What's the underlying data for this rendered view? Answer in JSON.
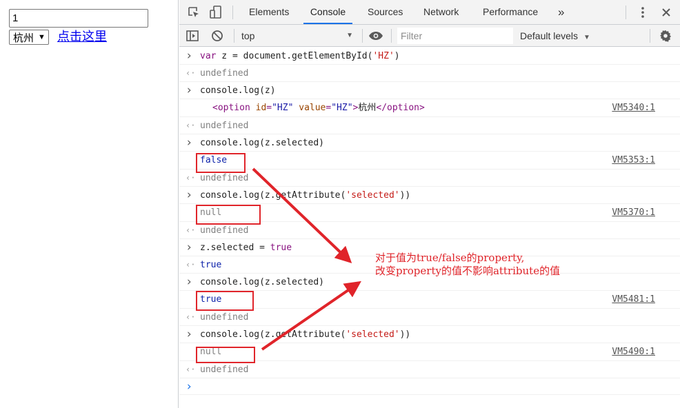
{
  "page": {
    "input_value": "1",
    "select_value": "杭州",
    "link_text": "点击这里"
  },
  "devtools": {
    "tabs": [
      "Elements",
      "Console",
      "Sources",
      "Network",
      "Performance"
    ],
    "active_tab": "Console",
    "more_tabs": "»",
    "context": "top",
    "filter_placeholder": "Filter",
    "levels": "Default levels"
  },
  "console": [
    {
      "kind": "input",
      "parts": [
        [
          "kw",
          "var"
        ],
        [
          "plain",
          " z = document.getElementById("
        ],
        [
          "str",
          "'HZ'"
        ],
        [
          "plain",
          ")"
        ]
      ]
    },
    {
      "kind": "return",
      "parts": [
        [
          "undef",
          "undefined"
        ]
      ]
    },
    {
      "kind": "input",
      "parts": [
        [
          "plain",
          "console.log(z)"
        ]
      ]
    },
    {
      "kind": "log",
      "parts": [
        [
          "tag",
          "<option "
        ],
        [
          "attr",
          "id"
        ],
        [
          "tag",
          "="
        ],
        [
          "aval",
          "\"HZ\""
        ],
        [
          "plain",
          " "
        ],
        [
          "attr",
          "value"
        ],
        [
          "tag",
          "="
        ],
        [
          "aval",
          "\"HZ\""
        ],
        [
          "tag",
          ">"
        ],
        [
          "plain",
          "杭州"
        ],
        [
          "tag",
          "</option>"
        ]
      ],
      "source": "VM5340:1"
    },
    {
      "kind": "return",
      "parts": [
        [
          "undef",
          "undefined"
        ]
      ]
    },
    {
      "kind": "input",
      "parts": [
        [
          "plain",
          "console.log(z.selected)"
        ]
      ]
    },
    {
      "kind": "log",
      "parts": [
        [
          "bool",
          "false"
        ]
      ],
      "source": "VM5353:1"
    },
    {
      "kind": "return",
      "parts": [
        [
          "undef",
          "undefined"
        ]
      ]
    },
    {
      "kind": "input",
      "parts": [
        [
          "plain",
          "console.log(z.getAttribute("
        ],
        [
          "str",
          "'selected'"
        ],
        [
          "plain",
          "))"
        ]
      ]
    },
    {
      "kind": "log",
      "parts": [
        [
          "null",
          "null"
        ]
      ],
      "source": "VM5370:1"
    },
    {
      "kind": "return",
      "parts": [
        [
          "undef",
          "undefined"
        ]
      ]
    },
    {
      "kind": "input",
      "parts": [
        [
          "plain",
          "z.selected = "
        ],
        [
          "kw",
          "true"
        ]
      ]
    },
    {
      "kind": "return",
      "parts": [
        [
          "bool",
          "true"
        ]
      ]
    },
    {
      "kind": "input",
      "parts": [
        [
          "plain",
          "console.log(z.selected)"
        ]
      ]
    },
    {
      "kind": "log",
      "parts": [
        [
          "bool",
          "true"
        ]
      ],
      "source": "VM5481:1"
    },
    {
      "kind": "return",
      "parts": [
        [
          "undef",
          "undefined"
        ]
      ]
    },
    {
      "kind": "input",
      "parts": [
        [
          "plain",
          "console.log(z.getAttribute("
        ],
        [
          "str",
          "'selected'"
        ],
        [
          "plain",
          "))"
        ]
      ]
    },
    {
      "kind": "log",
      "parts": [
        [
          "null",
          "null"
        ]
      ],
      "source": "VM5490:1"
    },
    {
      "kind": "return",
      "parts": [
        [
          "undef",
          "undefined"
        ]
      ]
    },
    {
      "kind": "prompt",
      "parts": []
    }
  ],
  "annotation": {
    "line1": "对于值为true/false的property,",
    "line2": "改变property的值不影响attribute的值",
    "color": "#e0242a"
  }
}
